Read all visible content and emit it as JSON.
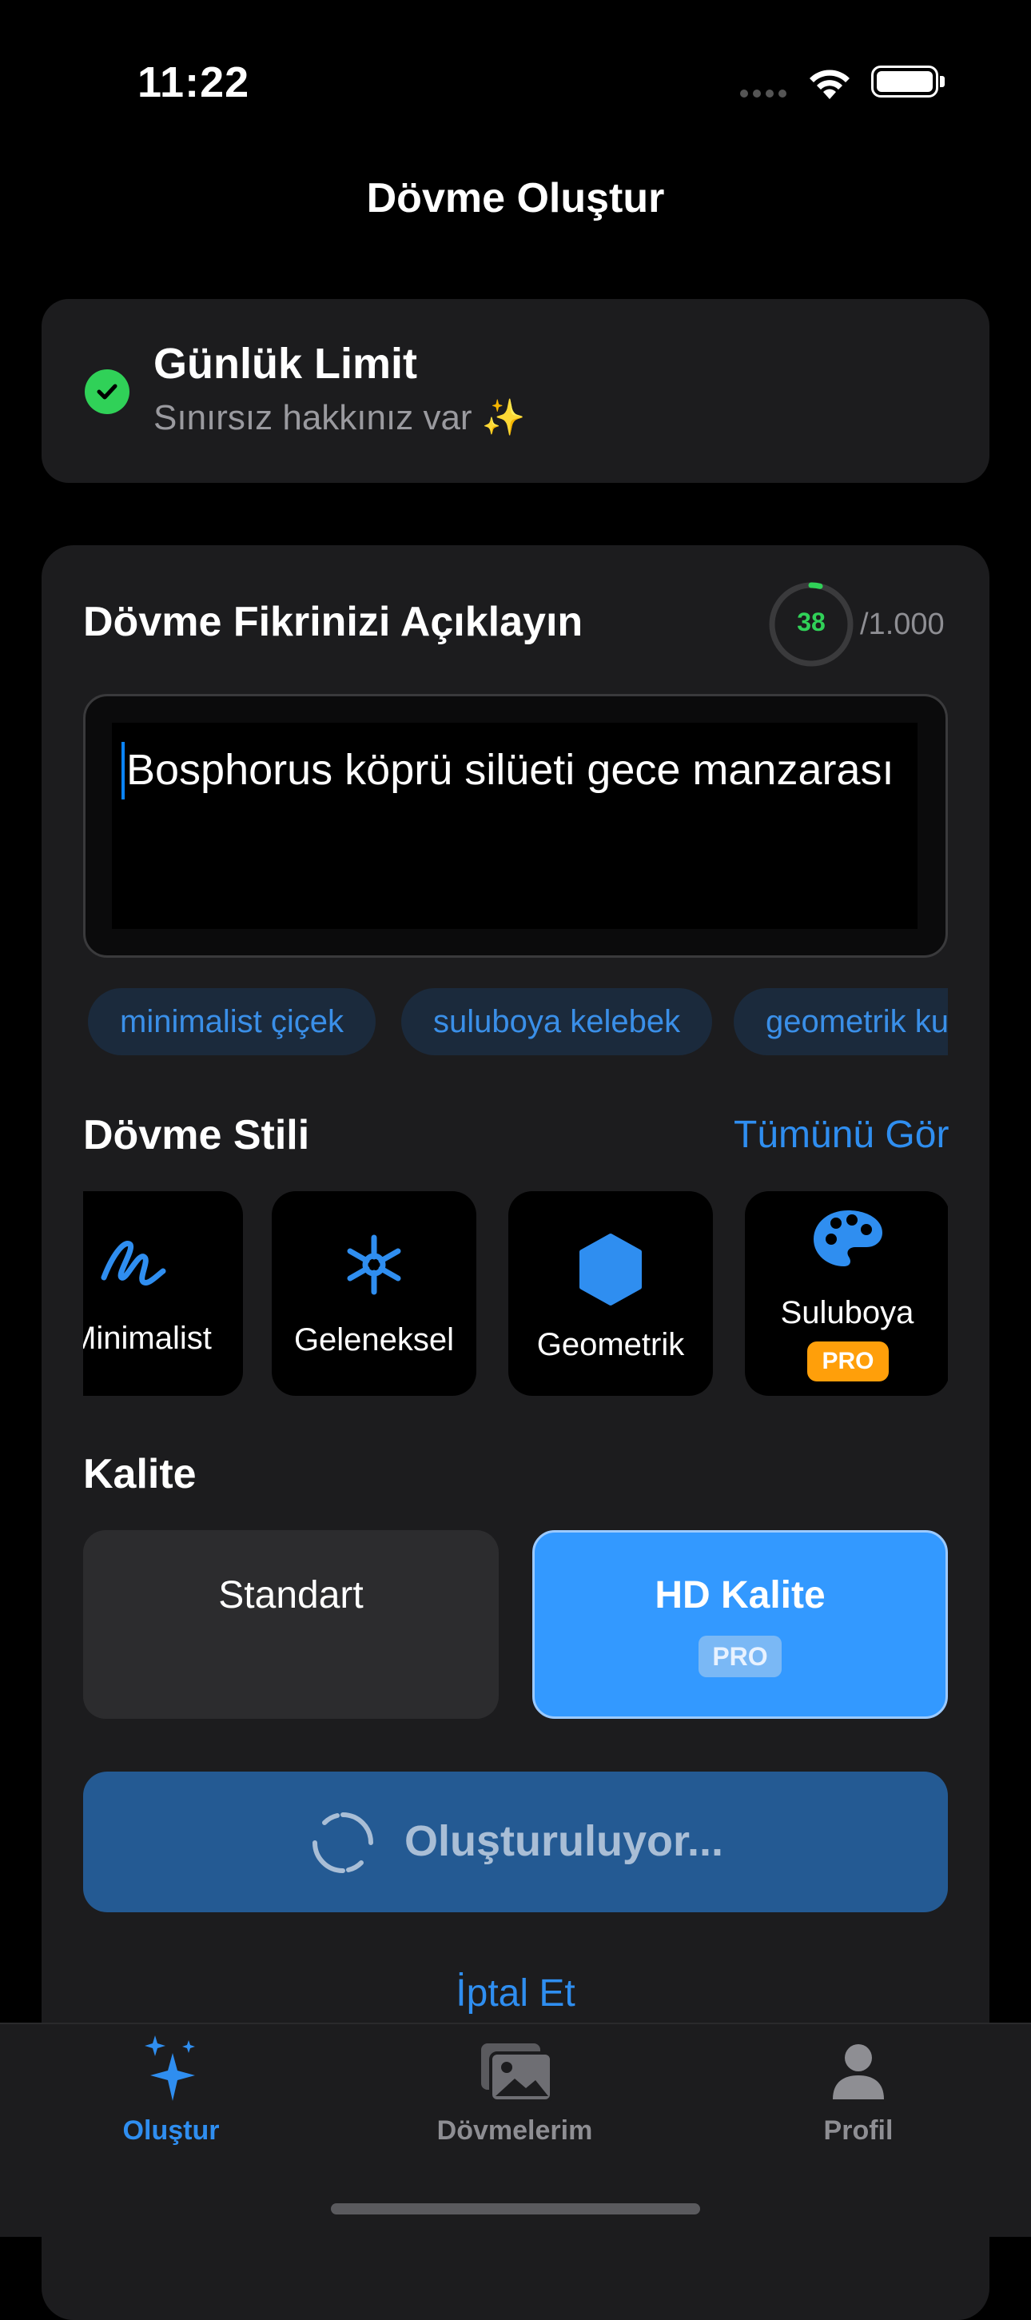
{
  "status_bar": {
    "time": "11:22"
  },
  "nav": {
    "title": "Dövme Oluştur"
  },
  "limit": {
    "title": "Günlük Limit",
    "subtitle": "Sınırsız hakkınız var ✨"
  },
  "description": {
    "title": "Dövme Fikrinizi Açıklayın",
    "count": "38",
    "max": "/1.000",
    "text": "Bosphorus köprü silüeti gece manzarası",
    "suggestions": [
      "minimalist çiçek",
      "suluboya kelebek",
      "geometrik kurt"
    ]
  },
  "style": {
    "title": "Dövme Stili",
    "see_all": "Tümünü Gör",
    "items": [
      {
        "label": "Minimalist",
        "icon": "scribble-icon"
      },
      {
        "label": "Geleneksel",
        "icon": "asterisk-icon"
      },
      {
        "label": "Geometrik",
        "icon": "hexagon-icon"
      },
      {
        "label": "Suluboya",
        "icon": "palette-icon",
        "badge": "PRO"
      }
    ]
  },
  "quality": {
    "title": "Kalite",
    "standard": "Standart",
    "hd": "HD Kalite",
    "hd_badge": "PRO",
    "selected": "hd"
  },
  "generate": {
    "label": "Oluşturuluyor..."
  },
  "cancel": {
    "label": "İptal Et"
  },
  "tabbar": {
    "items": [
      {
        "label": "Oluştur",
        "icon": "sparkles-icon",
        "active": true
      },
      {
        "label": "Dövmelerim",
        "icon": "photos-icon",
        "active": false
      },
      {
        "label": "Profil",
        "icon": "person-icon",
        "active": false
      }
    ]
  },
  "colors": {
    "accent": "#0a84ff",
    "success": "#30d158",
    "pro": "#ff9f0a",
    "card": "#1c1c1e"
  }
}
